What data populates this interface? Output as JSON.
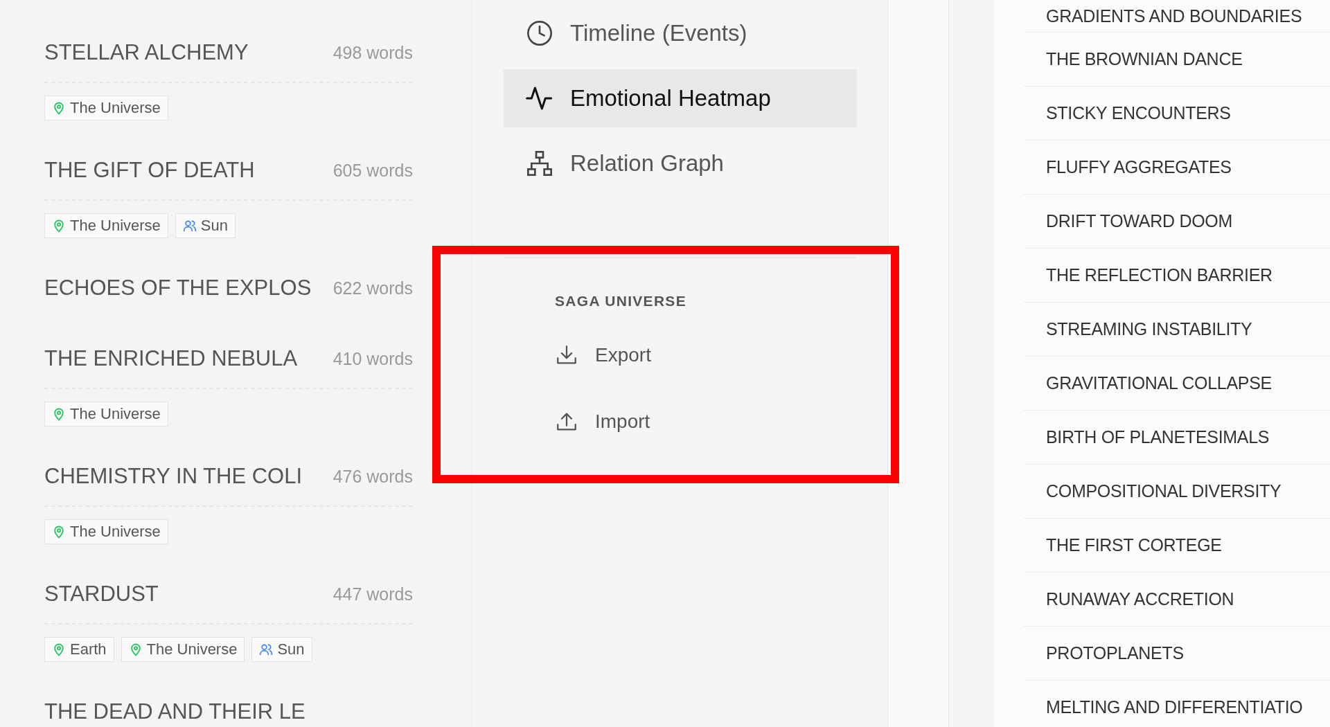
{
  "chapters": [
    {
      "title": "STELLAR ALCHEMY",
      "count": "498 words",
      "tags": [
        {
          "kind": "location",
          "label": "The Universe"
        }
      ]
    },
    {
      "title": "THE GIFT OF DEATH",
      "count": "605 words",
      "tags": [
        {
          "kind": "location",
          "label": "The Universe"
        },
        {
          "kind": "character",
          "label": "Sun"
        }
      ]
    },
    {
      "title": "ECHOES OF THE EXPLOS",
      "count": "622 words"
    },
    {
      "title": "THE ENRICHED NEBULA",
      "count": "410 words",
      "tags": [
        {
          "kind": "location",
          "label": "The Universe"
        }
      ]
    },
    {
      "title": "CHEMISTRY IN THE COLI",
      "count": "476 words",
      "tags": [
        {
          "kind": "location",
          "label": "The Universe"
        }
      ]
    },
    {
      "title": "STARDUST",
      "count": "447 words",
      "tags": [
        {
          "kind": "location",
          "label": "Earth"
        },
        {
          "kind": "location",
          "label": "The Universe"
        },
        {
          "kind": "character",
          "label": "Sun"
        }
      ]
    },
    {
      "title": "THE DEAD AND THEIR LE"
    }
  ],
  "views": [
    {
      "label": "Timeline (Events)",
      "selected": false
    },
    {
      "label": "Emotional Heatmap",
      "selected": true
    },
    {
      "label": "Relation Graph",
      "selected": false
    }
  ],
  "saga_section": {
    "heading": "SAGA UNIVERSE",
    "actions": [
      {
        "label": "Export"
      },
      {
        "label": "Import"
      }
    ]
  },
  "chapter_list": [
    "GRADIENTS AND BOUNDARIES",
    "THE BROWNIAN DANCE",
    "STICKY ENCOUNTERS",
    "FLUFFY AGGREGATES",
    "DRIFT TOWARD DOOM",
    "THE REFLECTION BARRIER",
    "STREAMING INSTABILITY",
    "GRAVITATIONAL COLLAPSE",
    "BIRTH OF PLANETESIMALS",
    "COMPOSITIONAL DIVERSITY",
    "THE FIRST CORTEGE",
    "RUNAWAY ACCRETION",
    "PROTOPLANETS",
    "MELTING AND DIFFERENTIATIO"
  ],
  "highlight": {
    "kind": "rectangle"
  }
}
